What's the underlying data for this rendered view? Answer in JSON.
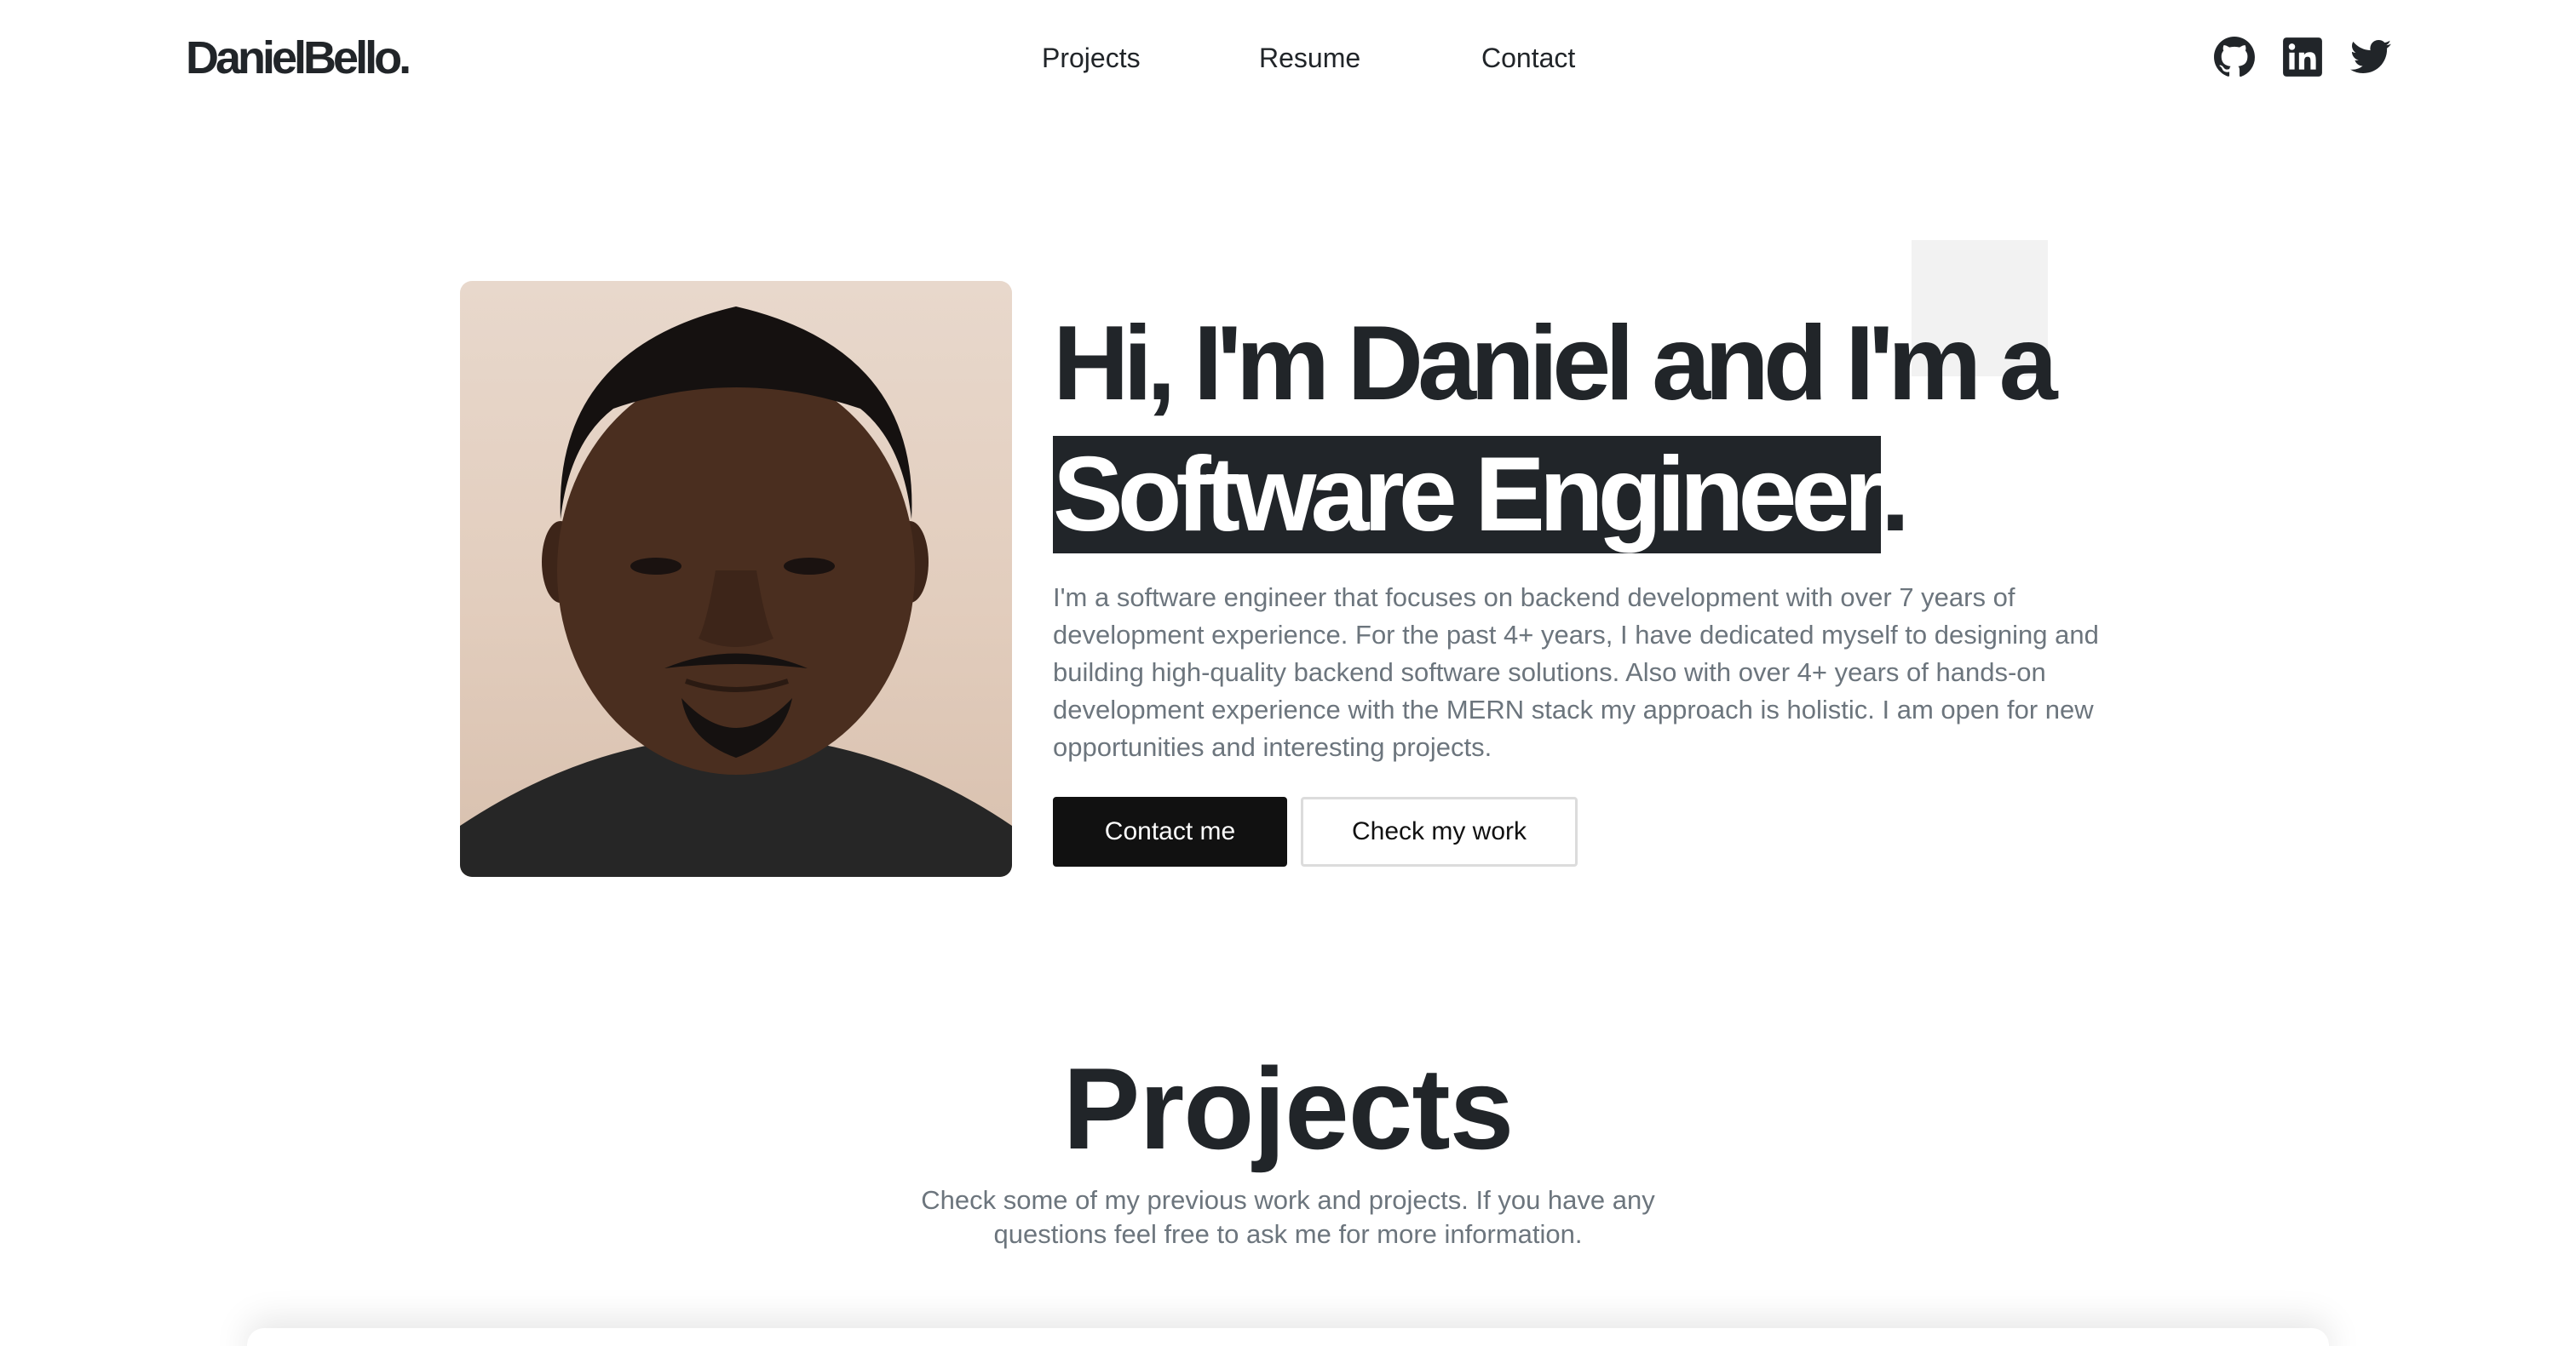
{
  "brand": {
    "logo": "DanielBello."
  },
  "nav": {
    "links": [
      "Projects",
      "Resume",
      "Contact"
    ],
    "social_icons": [
      "github-icon",
      "linkedin-icon",
      "twitter-icon"
    ]
  },
  "hero": {
    "title_line1": "Hi, I'm Daniel and I'm a",
    "title_highlight": "Software Engineer",
    "title_end": ".",
    "description": "I'm a software engineer that focuses on backend development with over 7 years of development experience. For the past 4+ years, I have dedicated myself to designing and building high-quality backend software solutions. Also with over 4+ years of hands-on development experience with the MERN stack my approach is holistic. I am open for new opportunities and interesting projects.",
    "primary_button": "Contact me",
    "secondary_button": "Check my work"
  },
  "projects": {
    "title": "Projects",
    "subtitle": "Check some of my previous work and projects. If you have any questions feel free to ask me for more information."
  },
  "colors": {
    "text": "#212529",
    "muted": "#6c757d",
    "button_dark": "#111111",
    "highlight_bg": "#212529"
  }
}
